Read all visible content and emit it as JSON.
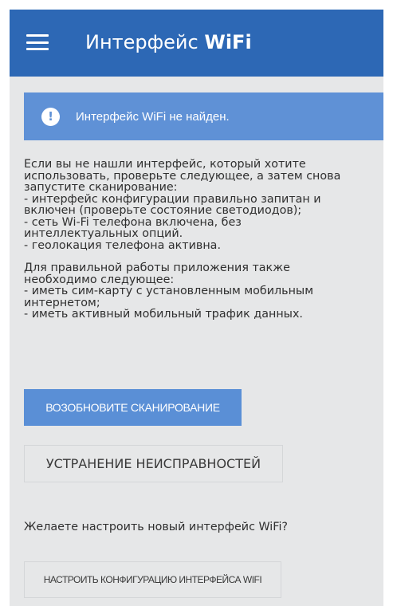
{
  "appbar": {
    "menu_icon": "hamburger-menu-icon",
    "title_prefix": "Интерфейс ",
    "title_bold": "WiFi"
  },
  "alert": {
    "icon": "exclamation-icon",
    "symbol": "!",
    "text": "Интерфейс WiFi не найден."
  },
  "content": {
    "paragraph1": "Если вы не нашли интерфейс, который хотите\nиспользовать, проверьте следующее, а затем снова\nзапустите сканирование:\n - интерфейс конфигурации правильно запитан и\nвключен (проверьте состояние светодиодов);\n - сеть Wi-Fi телефона включена, без\nинтеллектуальных опций.\n - геолокация телефона активна.",
    "paragraph2": "Для правильной работы приложения также\nнеобходимо следующее:\n - иметь сим-карту с установленным мобильным\nинтернетом;\n - иметь активный мобильный трафик данных."
  },
  "buttons": {
    "rescan_label": "ВОЗОБНОВИТЕ СКАНИРОВАНИЕ",
    "troubleshoot_label": "УСТРАНЕНИЕ НЕИСПРАВНОСТЕЙ",
    "configure_label": "НАСТРОИТЬ КОНФИГУРАЦИЮ ИНТЕРФЕЙСА WIFI"
  },
  "question": "Желаете настроить новый интерфейс WiFi?",
  "colors": {
    "appbar": "#2d68b5",
    "alert": "#5f91d6",
    "primary_button": "#5a8fd6",
    "background": "#e6e7e8"
  }
}
